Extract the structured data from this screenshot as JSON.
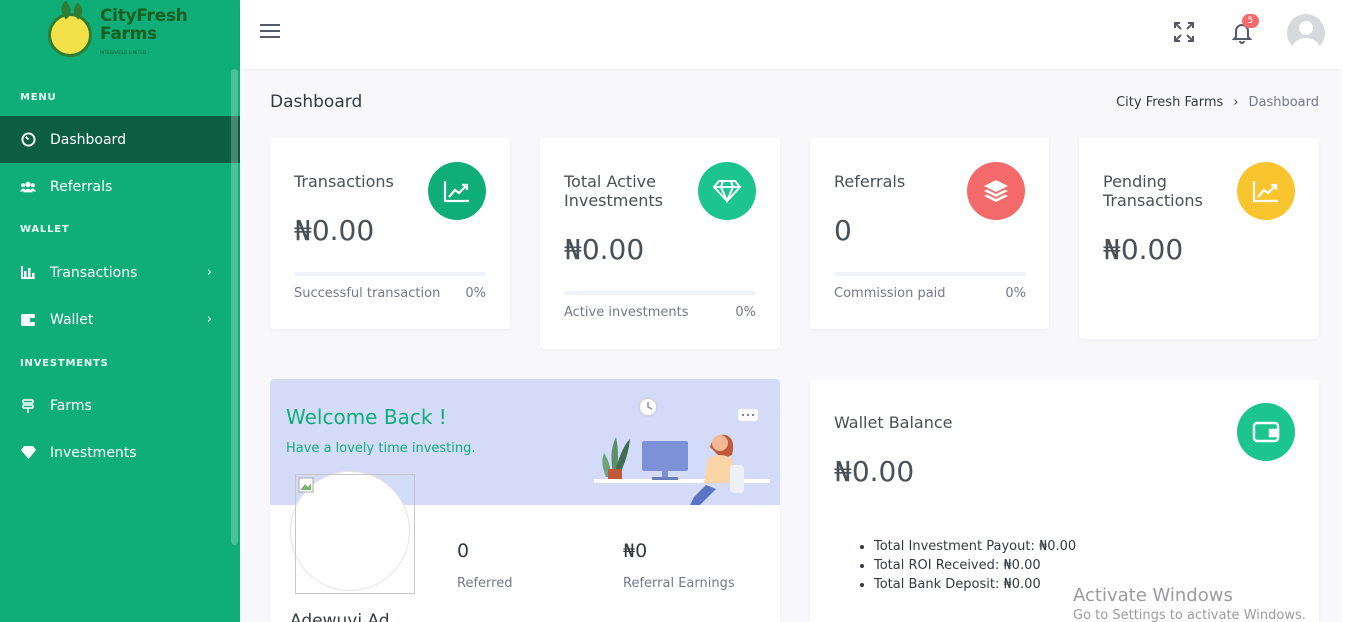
{
  "brand": {
    "name_line1": "CityFresh",
    "name_line2": "Farms",
    "tagline": "INTEGRATED LIMITED"
  },
  "sidebar": {
    "sections": [
      {
        "title": "MENU"
      },
      {
        "title": "WALLET"
      },
      {
        "title": "INVESTMENTS"
      }
    ],
    "items": [
      {
        "label": "Dashboard",
        "icon": "dashboard-icon"
      },
      {
        "label": "Referrals",
        "icon": "users-icon"
      },
      {
        "label": "Transactions",
        "icon": "bar-chart-icon",
        "arrow": "›"
      },
      {
        "label": "Wallet",
        "icon": "wallet-icon",
        "arrow": "›"
      },
      {
        "label": "Farms",
        "icon": "farm-icon"
      },
      {
        "label": "Investments",
        "icon": "diamond-icon"
      }
    ]
  },
  "topbar": {
    "notification_count": "5"
  },
  "page": {
    "title": "Dashboard",
    "breadcrumb": [
      "City Fresh Farms",
      "Dashboard"
    ]
  },
  "stats": [
    {
      "title": "Transactions",
      "value": "₦0.00",
      "foot_label": "Successful transaction",
      "foot_pct": "0%",
      "icon": "trend-up-icon",
      "color": "#0fad78",
      "progress": 0
    },
    {
      "title": "Total Active Investments",
      "value": "₦0.00",
      "foot_label": "Active investments",
      "foot_pct": "0%",
      "icon": "diamond-icon",
      "color": "#1bc58d",
      "progress": 0
    },
    {
      "title": "Referrals",
      "value": "0",
      "foot_label": "Commission paid",
      "foot_pct": "0%",
      "icon": "layers-icon",
      "color": "#f46a6a",
      "progress": 0
    },
    {
      "title": "Pending Transactions",
      "value": "₦0.00",
      "icon": "trend-up-icon",
      "color": "#f9c52f"
    }
  ],
  "welcome": {
    "title": "Welcome Back !",
    "subtitle": "Have a lovely time investing.",
    "user_name": "Adewuyi Ad",
    "referred_value": "0",
    "referred_label": "Referred",
    "earnings_value": "₦0",
    "earnings_label": "Referral Earnings"
  },
  "wallet": {
    "title": "Wallet Balance",
    "balance": "₦0.00",
    "items": [
      {
        "label": "Total Investment Payout:",
        "value": "₦0.00"
      },
      {
        "label": "Total ROI Received:",
        "value": "₦0.00"
      },
      {
        "label": "Total Bank Deposit:",
        "value": "₦0.00"
      }
    ]
  },
  "watermark": {
    "line1": "Activate Windows",
    "line2": "Go to Settings to activate Windows."
  }
}
